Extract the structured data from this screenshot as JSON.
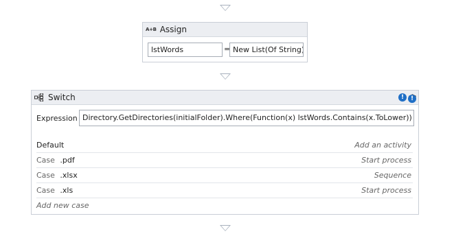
{
  "assign": {
    "title": "Assign",
    "icon": "A+B",
    "to_value": "lstWords",
    "equals": "=",
    "value": "New List(Of String)"
  },
  "switch": {
    "title": "Switch",
    "expression_label": "Expression",
    "expression_value": "Directory.GetDirectories(initialFolder).Where(Function(x) lstWords.Contains(x.ToLower))",
    "default_row": {
      "label": "Default",
      "action": "Add an activity"
    },
    "cases": [
      {
        "prefix": "Case",
        "value": ".pdf",
        "action": "Start process"
      },
      {
        "prefix": "Case",
        "value": ".xlsx",
        "action": "Sequence"
      },
      {
        "prefix": "Case",
        "value": ".xls",
        "action": "Start process"
      }
    ],
    "add_case": "Add new case",
    "info_glyph": "!",
    "collapse_glyph": "︽"
  },
  "colors": {
    "header_bg": "#eceef2",
    "border": "#c9ced6",
    "info_blue": "#1f6fc6",
    "arrow": "#a8b1bd"
  }
}
